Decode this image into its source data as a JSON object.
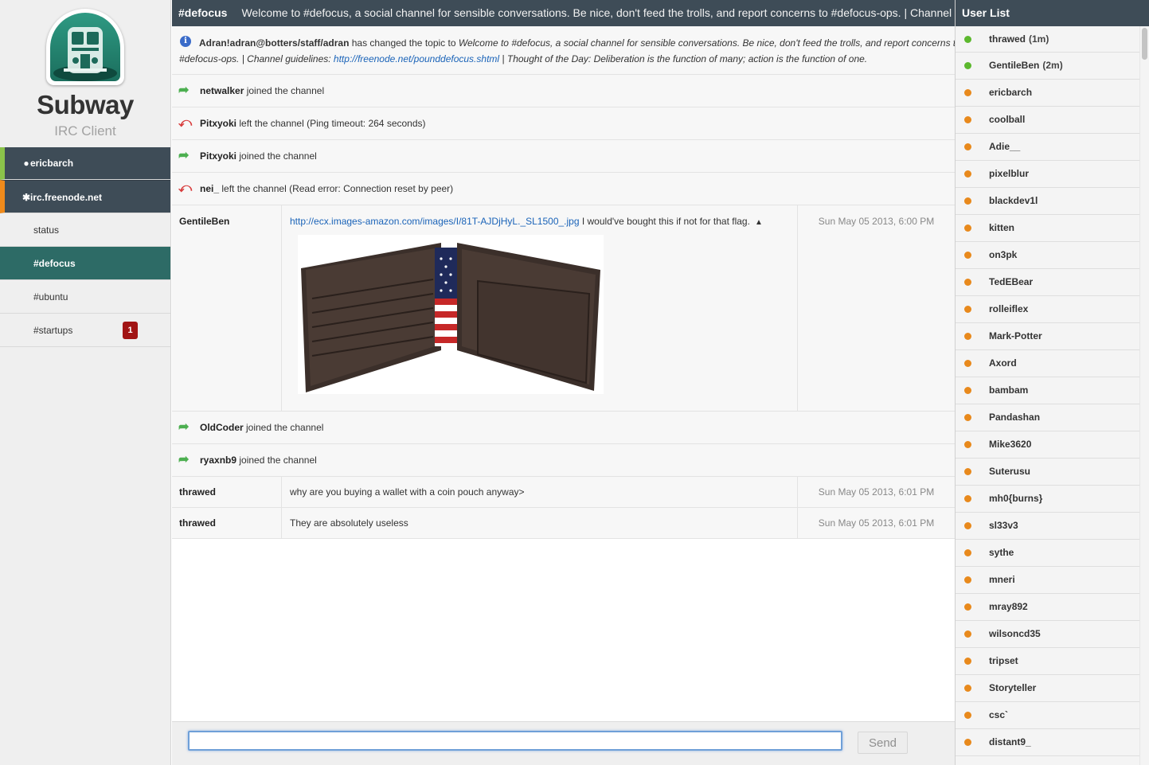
{
  "app": {
    "title": "Subway",
    "subtitle": "IRC Client"
  },
  "sidebar": {
    "user": {
      "label": "ericbarch",
      "icon": "user-icon"
    },
    "server": {
      "label": "irc.freenode.net",
      "icon": "gear-icon"
    },
    "channels": [
      {
        "label": "status",
        "active": false,
        "badge": ""
      },
      {
        "label": "#defocus",
        "active": true,
        "badge": ""
      },
      {
        "label": "#ubuntu",
        "active": false,
        "badge": ""
      },
      {
        "label": "#startups",
        "active": false,
        "badge": "1"
      }
    ]
  },
  "topbar": {
    "channel": "#defocus",
    "topic": "Welcome to #defocus, a social channel for sensible conversations. Be nice, don't feed the trolls, and report concerns to #defocus-ops. | Channel guidelines: http://freenode.net/pounddefocus.shtml"
  },
  "topic_message": {
    "actor": "Adran!adran@botters/staff/adran",
    "action": " has changed the topic to ",
    "topic_part1": "Welcome to #defocus, a social channel for sensible conversations. Be nice, don't feed the trolls, and report concerns to",
    "topic_part2": "#defocus-ops. | Channel guidelines: ",
    "topic_link": "http://freenode.net/pounddefocus.shtml",
    "topic_part3": " | Thought of the Day: Deliberation is the function of many; action is the function of one."
  },
  "events": [
    {
      "nick": "netwalker",
      "text": " joined the channel"
    },
    {
      "nick": "Pitxyoki",
      "text": " left the channel (Ping timeout: 264 seconds)"
    },
    {
      "nick": "Pitxyoki",
      "text": " joined the channel"
    },
    {
      "nick": "nei_",
      "text": " left the channel (Read error: Connection reset by peer)"
    },
    {
      "nick": "OldCoder",
      "text": " joined the channel"
    },
    {
      "nick": "ryaxnb9",
      "text": " joined the channel"
    }
  ],
  "messages": [
    {
      "nick": "GentileBen",
      "link": "http://ecx.images-amazon.com/images/I/81T-AJDjHyL._SL1500_.jpg",
      "text": " I would've bought this if not for that flag.",
      "time": "Sun May 05 2013, 6:00 PM"
    },
    {
      "nick": "thrawed",
      "text": "why are you buying a wallet with a coin pouch anyway>",
      "time": "Sun May 05 2013, 6:01 PM"
    },
    {
      "nick": "thrawed",
      "text": "They are absolutely useless",
      "time": "Sun May 05 2013, 6:01 PM"
    }
  ],
  "input": {
    "value": "",
    "send_label": "Send"
  },
  "userlist": {
    "title": "User List",
    "colors": {
      "active": "#5cb82e",
      "away": "#e8891c"
    },
    "users": [
      {
        "name": "thrawed",
        "idle": "(1m)",
        "status": "active"
      },
      {
        "name": "GentileBen",
        "idle": "(2m)",
        "status": "active"
      },
      {
        "name": "ericbarch",
        "idle": "",
        "status": "away"
      },
      {
        "name": "coolball",
        "idle": "",
        "status": "away"
      },
      {
        "name": "Adie__",
        "idle": "",
        "status": "away"
      },
      {
        "name": "pixelblur",
        "idle": "",
        "status": "away"
      },
      {
        "name": "blackdev1l",
        "idle": "",
        "status": "away"
      },
      {
        "name": "kitten",
        "idle": "",
        "status": "away"
      },
      {
        "name": "on3pk",
        "idle": "",
        "status": "away"
      },
      {
        "name": "TedEBear",
        "idle": "",
        "status": "away"
      },
      {
        "name": "rolleiflex",
        "idle": "",
        "status": "away"
      },
      {
        "name": "Mark-Potter",
        "idle": "",
        "status": "away"
      },
      {
        "name": "Axord",
        "idle": "",
        "status": "away"
      },
      {
        "name": "bambam",
        "idle": "",
        "status": "away"
      },
      {
        "name": "Pandashan",
        "idle": "",
        "status": "away"
      },
      {
        "name": "Mike3620",
        "idle": "",
        "status": "away"
      },
      {
        "name": "Suterusu",
        "idle": "",
        "status": "away"
      },
      {
        "name": "mh0{burns}",
        "idle": "",
        "status": "away"
      },
      {
        "name": "sl33v3",
        "idle": "",
        "status": "away"
      },
      {
        "name": "sythe",
        "idle": "",
        "status": "away"
      },
      {
        "name": "mneri",
        "idle": "",
        "status": "away"
      },
      {
        "name": "mray892",
        "idle": "",
        "status": "away"
      },
      {
        "name": "wilsoncd35",
        "idle": "",
        "status": "away"
      },
      {
        "name": "tripset",
        "idle": "",
        "status": "away"
      },
      {
        "name": "Storyteller",
        "idle": "",
        "status": "away"
      },
      {
        "name": "csc`",
        "idle": "",
        "status": "away"
      },
      {
        "name": "distant9_",
        "idle": "",
        "status": "away"
      }
    ]
  }
}
